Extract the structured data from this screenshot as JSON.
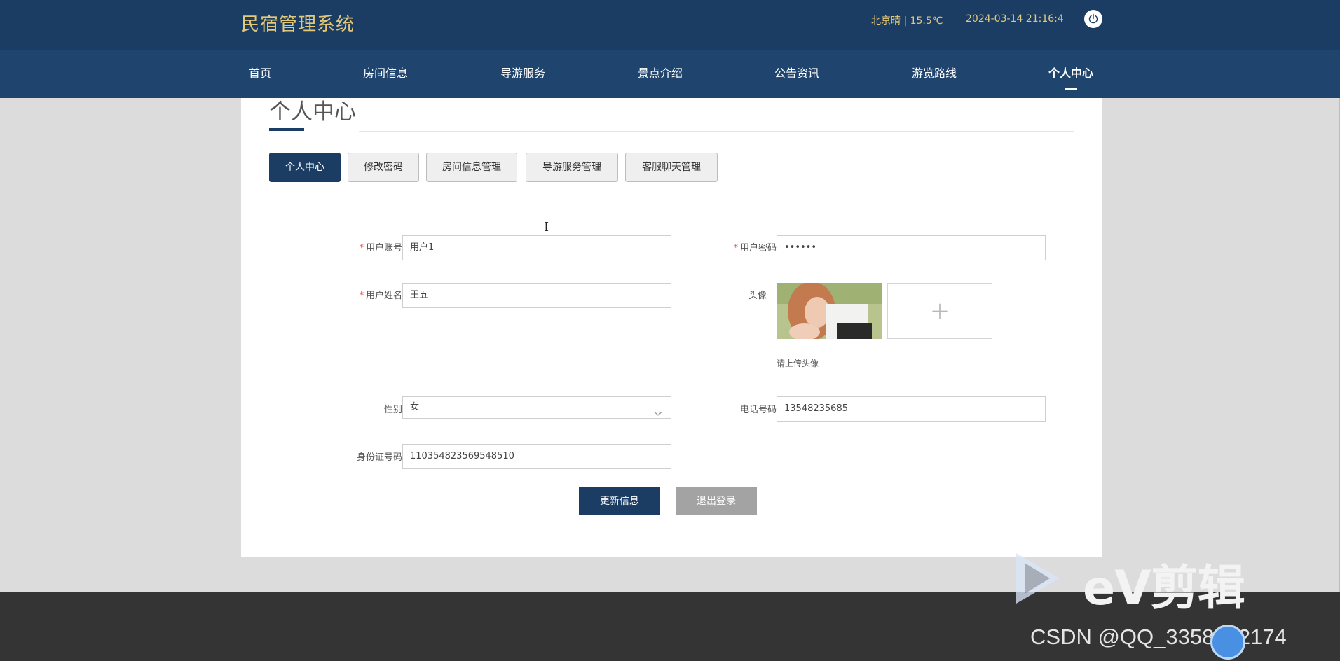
{
  "header": {
    "logo": "民宿管理系统",
    "weather": "北京晴 | 15.5℃",
    "datetime": "2024-03-14  21:16:4"
  },
  "nav": {
    "items": [
      "首页",
      "房间信息",
      "导游服务",
      "景点介绍",
      "公告资讯",
      "游览路线",
      "个人中心"
    ],
    "active": "个人中心"
  },
  "page": {
    "title": "个人中心",
    "tabs": [
      "个人中心",
      "修改密码",
      "房间信息管理",
      "导游服务管理",
      "客服聊天管理"
    ],
    "active_tab": "个人中心"
  },
  "form": {
    "account_label": "用户账号",
    "account_value": "用户1",
    "password_label": "用户密码",
    "password_value": "••••••",
    "name_label": "用户姓名",
    "name_value": "王五",
    "avatar_label": "头像",
    "avatar_hint": "请上传头像",
    "gender_label": "性别",
    "gender_value": "女",
    "phone_label": "电话号码",
    "phone_value": "13548235685",
    "idcard_label": "身份证号码",
    "idcard_value": "110354823569548510"
  },
  "actions": {
    "update": "更新信息",
    "logout": "退出登录"
  },
  "watermarks": {
    "ev": "eV剪辑",
    "csdn": "CSDN @QQ_3358892174"
  },
  "colors": {
    "header_bg": "#1c3d63",
    "nav_bg": "#1f456f",
    "accent_gold": "#e3c87a",
    "primary": "#1c3d63",
    "required": "#e74c3c"
  }
}
